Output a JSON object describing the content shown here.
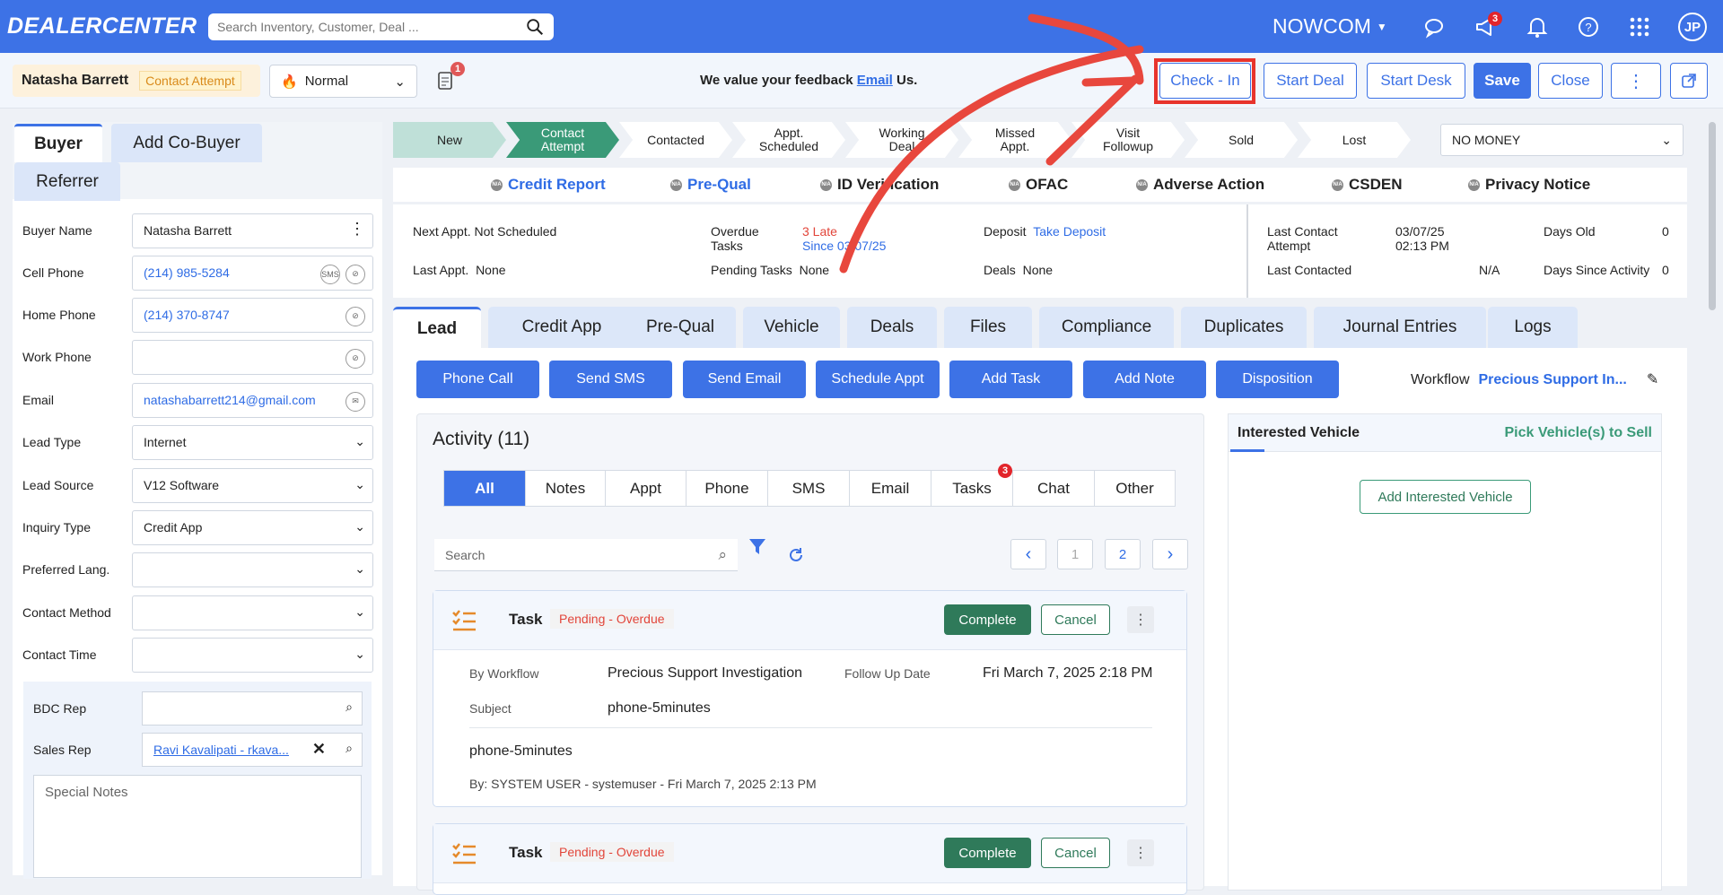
{
  "topnav": {
    "logo": "DEALERCENTER",
    "search_placeholder": "Search Inventory, Customer, Deal ...",
    "org": "NOWCOM",
    "notif_count": "3",
    "avatar": "JP",
    "icons": [
      "chat-icon",
      "megaphone-icon",
      "bell-icon",
      "help-icon",
      "apps-grid-icon"
    ]
  },
  "header": {
    "customer_name": "Natasha Barrett",
    "status": "Contact Attempt",
    "priority": "Normal",
    "doc_badge": "1",
    "feedback_prefix": "We value your feedback",
    "feedback_link": "Email",
    "feedback_suffix": "Us.",
    "buttons": {
      "check_in": "Check - In",
      "start_deal": "Start Deal",
      "start_desk": "Start Desk",
      "save": "Save",
      "close": "Close"
    }
  },
  "left": {
    "tabs": [
      "Buyer",
      "Add Co-Buyer",
      "Referrer"
    ],
    "fields": [
      {
        "label": "Buyer Name",
        "value": "Natasha Barrett"
      },
      {
        "label": "Cell Phone",
        "value": "(214) 985-5284"
      },
      {
        "label": "Home Phone",
        "value": "(214) 370-8747"
      },
      {
        "label": "Work Phone",
        "value": ""
      },
      {
        "label": "Email",
        "value": "natashabarrett214@gmail.com"
      },
      {
        "label": "Lead Type",
        "value": "Internet"
      },
      {
        "label": "Lead Source",
        "value": "V12 Software"
      },
      {
        "label": "Inquiry Type",
        "value": "Credit App"
      },
      {
        "label": "Preferred Lang.",
        "value": ""
      },
      {
        "label": "Contact Method",
        "value": ""
      },
      {
        "label": "Contact Time",
        "value": ""
      }
    ],
    "sms_label": "SMS",
    "bdc_label": "BDC Rep",
    "sales_label": "Sales Rep",
    "sales_value": "Ravi Kavalipati - rkava...",
    "notes_placeholder": "Special Notes"
  },
  "pipeline": {
    "stages": [
      "New",
      "Contact\nAttempt",
      "Contacted",
      "Appt.\nScheduled",
      "Working\nDeal",
      "Missed\nAppt.",
      "Visit\nFollowup",
      "Sold",
      "Lost"
    ],
    "current_index": 1,
    "money": "NO MONEY"
  },
  "reports": [
    {
      "label": "Credit Report",
      "na": "N/A"
    },
    {
      "label": "Pre-Qual",
      "na": "N/A"
    },
    {
      "label": "ID Verification",
      "na": "N/A"
    },
    {
      "label": "OFAC",
      "na": "N/A"
    },
    {
      "label": "Adverse Action",
      "na": "N/A"
    },
    {
      "label": "CSDEN",
      "na": "N/A"
    },
    {
      "label": "Privacy Notice",
      "na": "N/A"
    }
  ],
  "info": {
    "next_appt": "Next Appt. Not Scheduled",
    "last_appt_label": "Last Appt.",
    "last_appt": "None",
    "overdue_label": "Overdue Tasks",
    "overdue_late": "3 Late",
    "overdue_since": "Since 03/07/25",
    "pending_label": "Pending Tasks",
    "pending": "None",
    "deposit_label": "Deposit",
    "deposit_link": "Take Deposit",
    "deals_label": "Deals",
    "deals": "None",
    "last_contact_attempt_label": "Last Contact Attempt",
    "last_contact_attempt": "03/07/25 02:13 PM",
    "last_contacted_label": "Last Contacted",
    "last_contacted": "N/A",
    "days_old_label": "Days Old",
    "days_old": "0",
    "days_since_label": "Days Since Activity",
    "days_since": "0"
  },
  "main_tabs": [
    "Lead",
    "Credit App",
    "Pre-Qual",
    "Vehicle",
    "Deals",
    "Files",
    "Compliance",
    "Duplicates",
    "Journal Entries",
    "Logs"
  ],
  "actions": [
    "Phone Call",
    "Send SMS",
    "Send Email",
    "Schedule Appt",
    "Add Task",
    "Add Note",
    "Disposition"
  ],
  "workflow": {
    "label": "Workflow",
    "value": "Precious Support In..."
  },
  "activity": {
    "title": "Activity (11)",
    "filters": [
      "All",
      "Notes",
      "Appt",
      "Phone",
      "SMS",
      "Email",
      "Tasks",
      "Chat",
      "Other"
    ],
    "tasks_badge": "3",
    "search_placeholder": "Search",
    "pages": [
      "1",
      "2"
    ],
    "cards": [
      {
        "title": "Task",
        "status": "Pending - Overdue",
        "complete": "Complete",
        "cancel": "Cancel",
        "by_label": "By Workflow",
        "by_value": "Precious Support Investigation",
        "follow_label": "Follow Up Date",
        "follow_value": "Fri March 7, 2025 2:18 PM",
        "subject_label": "Subject",
        "subject_value": "phone-5minutes",
        "body": "phone-5minutes",
        "footer": "By: SYSTEM USER - systemuser - Fri March 7, 2025 2:13 PM"
      },
      {
        "title": "Task",
        "status": "Pending - Overdue",
        "complete": "Complete",
        "cancel": "Cancel"
      }
    ]
  },
  "interested": {
    "title": "Interested Vehicle",
    "link": "Pick Vehicle(s) to Sell",
    "add": "Add Interested Vehicle"
  },
  "colors": {
    "brand": "#3d72e6",
    "stage_current": "#3a9a78",
    "annotation": "#e8342c"
  }
}
